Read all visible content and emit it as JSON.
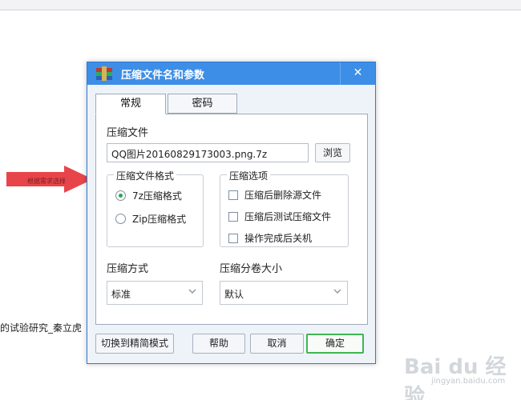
{
  "background": {
    "text": "的试验研究_秦立虎"
  },
  "annotation": {
    "label": "根据需求选择",
    "arrow_color": "#e8454a"
  },
  "dialog": {
    "title": "压缩文件名和参数",
    "close_symbol": "✕",
    "icon": "winrar-archive-icon",
    "tabs": [
      {
        "label": "常规",
        "active": true
      },
      {
        "label": "密码",
        "active": false
      }
    ],
    "archive_name": {
      "label": "压缩文件",
      "value": "QQ图片20160829173003.png.7z",
      "browse_label": "浏览"
    },
    "format_group": {
      "title": "压缩文件格式",
      "options": [
        {
          "label": "7z压缩格式",
          "selected": true
        },
        {
          "label": "Zip压缩格式",
          "selected": false
        }
      ]
    },
    "options_group": {
      "title": "压缩选项",
      "options": [
        {
          "label": "压缩后删除源文件",
          "checked": false
        },
        {
          "label": "压缩后测试压缩文件",
          "checked": false
        },
        {
          "label": "操作完成后关机",
          "checked": false
        }
      ]
    },
    "method": {
      "label": "压缩方式",
      "value": "标准"
    },
    "split": {
      "label": "压缩分卷大小",
      "value": "默认"
    },
    "buttons": {
      "simple_mode": "切换到精简模式",
      "help": "帮助",
      "cancel": "取消",
      "ok": "确定"
    }
  },
  "watermark": {
    "main": "Bai du 经验",
    "sub": "jingyan.baidu.com"
  },
  "colors": {
    "titlebar": "#3d8ee6",
    "radio_selected": "#2aa84a",
    "ok_border": "#3fb552"
  }
}
